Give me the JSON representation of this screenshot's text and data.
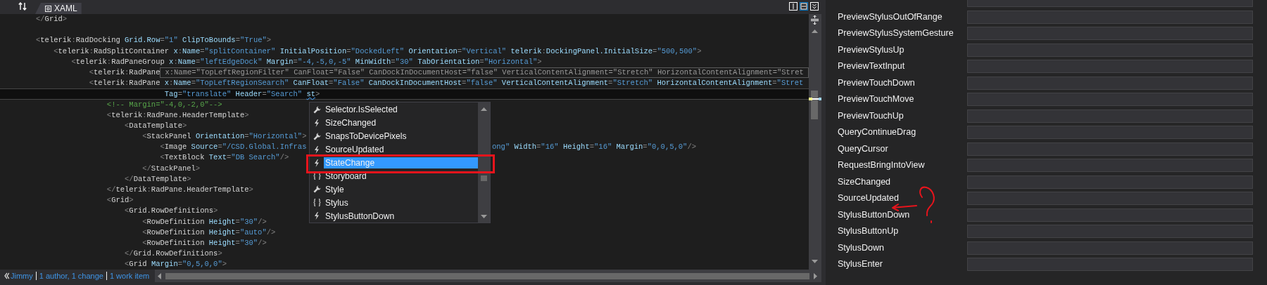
{
  "toolbar": {
    "tab_label": "XAML"
  },
  "editor": {
    "lines": [
      {
        "text": "</Grid>",
        "current": false
      },
      {
        "current": false
      },
      {
        "text": "<telerik:RadDocking Grid.Row=\"1\" ClipToBounds=\"True\">",
        "current": false
      },
      {
        "text": "    <telerik:RadSplitContainer x:Name=\"splitContainer\" InitialPosition=\"DockedLeft\" Orientation=\"Vertical\" telerik:DockingPanel.InitialSize=\"500,500\">",
        "current": false
      },
      {
        "text": "        <telerik:RadPaneGroup x:Name=\"leftEdgeDock\" Margin=\"-4,-5,0,-5\" MinWidth=\"30\" TabOrientation=\"Horizontal\">",
        "current": false
      },
      {
        "text": "            <telerik:RadPane",
        "current": false,
        "tooltip": "x:Name=\"TopLeftRegionFilter\" CanFloat=\"False\" CanDockInDocumentHost=\"false\" VerticalContentAlignment=\"Stretch\" HorizontalContentAlignment=\"Stret"
      },
      {
        "text": "            <telerik:RadPane x:Name=\"TopLeftRegionSearch\" CanFloat=\"False\" CanDockInDocumentHost=\"false\" VerticalContentAlignment=\"Stretch\" HorizontalContentAlignment=\"Stret",
        "current": false
      },
      {
        "text": "                             Tag=\"translate\" Header=\"Search\" ",
        "current": true,
        "squiggle": "st",
        "rest": ">"
      },
      {
        "text": "                <!-- Margin=\"-4,0,-2,0\"-->",
        "current": false
      },
      {
        "text": "                <telerik:RadPane.HeaderTemplate>",
        "current": false
      },
      {
        "text": "                    <DataTemplate>",
        "current": false
      },
      {
        "text": "                        <StackPanel Orientation=\"Horizontal\">",
        "current": false
      },
      {
        "text": "                            <Image Source=\"/CSD.Global.Infras",
        "current": false,
        "tail": "ong\" Width=\"16\" Height=\"16\" Margin=\"0,0,5,0\"/>"
      },
      {
        "text": "                            <TextBlock Text=\"DB Search\"/>",
        "current": false
      },
      {
        "text": "                        </StackPanel>",
        "current": false
      },
      {
        "text": "                    </DataTemplate>",
        "current": false
      },
      {
        "text": "                </telerik:RadPane.HeaderTemplate>",
        "current": false
      },
      {
        "text": "                <Grid>",
        "current": false
      },
      {
        "text": "                    <Grid.RowDefinitions>",
        "current": false
      },
      {
        "text": "                        <RowDefinition Height=\"30\"/>",
        "current": false
      },
      {
        "text": "                        <RowDefinition Height=\"auto\"/>",
        "current": false
      },
      {
        "text": "                        <RowDefinition Height=\"30\"/>",
        "current": false
      },
      {
        "text": "                    </Grid.RowDefinitions>",
        "current": false
      },
      {
        "text": "                    <Grid Margin=\"0,5,0,0\">",
        "current": false
      }
    ],
    "completion": {
      "items": [
        {
          "label": "Selector.IsSelected",
          "kind": "property",
          "selected": false
        },
        {
          "label": "SizeChanged",
          "kind": "event",
          "selected": false
        },
        {
          "label": "SnapsToDevicePixels",
          "kind": "property",
          "selected": false
        },
        {
          "label": "SourceUpdated",
          "kind": "event",
          "selected": false
        },
        {
          "label": "StateChange",
          "kind": "event",
          "selected": true
        },
        {
          "label": "Storyboard",
          "kind": "namespace",
          "selected": false
        },
        {
          "label": "Style",
          "kind": "property",
          "selected": false
        },
        {
          "label": "Stylus",
          "kind": "namespace",
          "selected": false
        },
        {
          "label": "StylusButtonDown",
          "kind": "event",
          "selected": false
        }
      ]
    }
  },
  "status_bar": {
    "author": "Jimmy",
    "changes": "1 author, 1 change",
    "work_items": "1 work item"
  },
  "events": [
    {
      "name": "PreviewStylusOutOfRange"
    },
    {
      "name": "PreviewStylusSystemGesture"
    },
    {
      "name": "PreviewStylusUp"
    },
    {
      "name": "PreviewTextInput"
    },
    {
      "name": "PreviewTouchDown"
    },
    {
      "name": "PreviewTouchMove"
    },
    {
      "name": "PreviewTouchUp"
    },
    {
      "name": "QueryContinueDrag"
    },
    {
      "name": "QueryCursor"
    },
    {
      "name": "RequestBringIntoView"
    },
    {
      "name": "SizeChanged"
    },
    {
      "name": "SourceUpdated"
    },
    {
      "name": "StylusButtonDown"
    },
    {
      "name": "StylusButtonUp"
    },
    {
      "name": "StylusDown"
    },
    {
      "name": "StylusEnter"
    }
  ]
}
